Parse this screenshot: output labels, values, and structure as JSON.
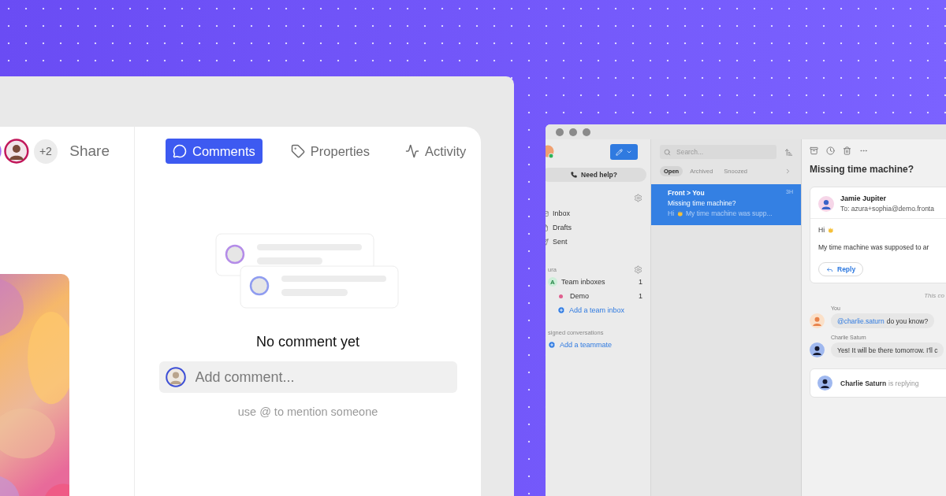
{
  "comments_window": {
    "extra_count": "+2",
    "share": "Share",
    "tabs": [
      {
        "label": "Comments",
        "kind": "comments",
        "selected": true
      },
      {
        "label": "Properties",
        "kind": "properties",
        "selected": false
      },
      {
        "label": "Activity",
        "kind": "activity",
        "selected": false
      }
    ],
    "empty_state": {
      "title": "No comment yet"
    },
    "comment_input": {
      "placeholder": "Add comment..."
    },
    "hint": "use @ to mention someone"
  },
  "inbox_window": {
    "help_button": "Need help?",
    "sidebar": {
      "items": [
        {
          "label": "Inbox",
          "kind": "inbox"
        },
        {
          "label": "Drafts",
          "kind": "drafts"
        },
        {
          "label": "Sent",
          "kind": "sent"
        }
      ]
    },
    "team_section": {
      "title": "ura",
      "items": [
        {
          "label": "Team inboxes",
          "count": "1",
          "kind": "team",
          "badge": "A"
        },
        {
          "label": "Demo",
          "count": "1",
          "kind": "inbox",
          "color": "#e0608f"
        }
      ],
      "add_link": "Add a team inbox"
    },
    "assigned_section": {
      "title": "signed conversations",
      "add_link": "Add a teammate"
    },
    "search": {
      "placeholder": "Search..."
    },
    "filter_tabs": [
      {
        "label": "Open",
        "selected": true
      },
      {
        "label": "Archived",
        "selected": false
      },
      {
        "label": "Snoozed",
        "selected": false
      }
    ],
    "conversations": [
      {
        "from": "Front > You",
        "time": "3H",
        "subject": "Missing time machine?",
        "greeting": "Hi",
        "preview": "My time machine was supp...",
        "selected": true
      }
    ],
    "thread": {
      "title": "Missing time machine?",
      "message": {
        "sender": "Jamie Jupiter",
        "recipients": "To: azura+sophia@demo.fronta",
        "greeting": "Hi",
        "body": "My time machine was supposed to ar",
        "reply": "Reply"
      },
      "notice": "This co",
      "comments": [
        {
          "author": "You",
          "kind": "mention",
          "mention": "@charlie.saturn",
          "text": "do you know?"
        },
        {
          "author": "Charlie Saturn",
          "kind": "plain",
          "text": "Yes! It will be there tomorrow. I'll c"
        }
      ],
      "typing": {
        "name": "Charlie Saturn",
        "status": "is replying"
      }
    }
  }
}
